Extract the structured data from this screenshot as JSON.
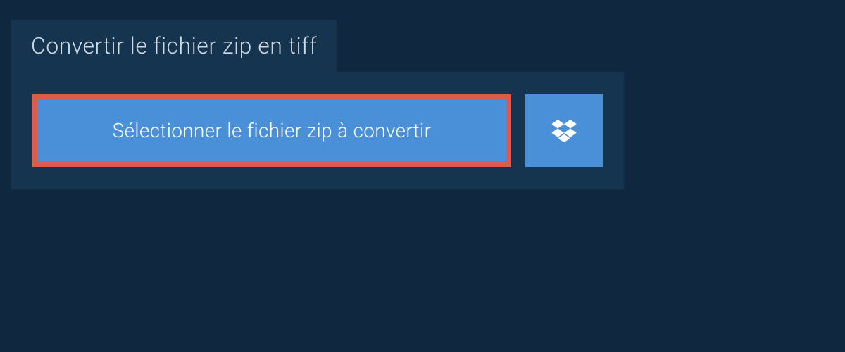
{
  "header": {
    "title": "Convertir le fichier zip en tiff"
  },
  "buttons": {
    "select_file_label": "Sélectionner le fichier zip à convertir"
  },
  "colors": {
    "bg_dark": "#0f2840",
    "bg_panel": "#14344f",
    "btn_primary": "#4a90d9",
    "btn_border_highlight": "#de5a4e",
    "text_light": "#d0d8e0"
  }
}
